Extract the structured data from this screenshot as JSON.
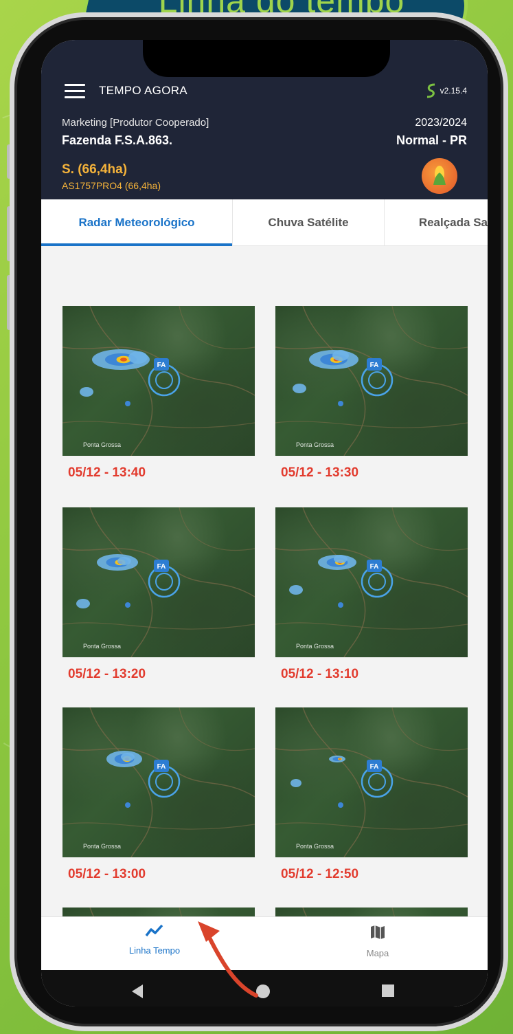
{
  "banner": {
    "title": "Linha do tempo"
  },
  "header": {
    "app_title": "TEMPO AGORA",
    "version": "v2.15.4",
    "role": "Marketing [Produtor Cooperado]",
    "farm": "Fazenda F.S.A.863.",
    "season": "2023/2024",
    "season_type": "Normal - PR",
    "plot": "S. (66,4ha)",
    "plot_detail": "AS1757PRO4 (66,4ha)",
    "crop_icon": "corn-icon"
  },
  "tabs": [
    {
      "label": "Radar Meteorológico",
      "active": true
    },
    {
      "label": "Chuva Satélite",
      "active": false
    },
    {
      "label": "Realçada Sa",
      "active": false
    }
  ],
  "radar_images": [
    {
      "timestamp": "05/12 - 13:40"
    },
    {
      "timestamp": "05/12 - 13:30"
    },
    {
      "timestamp": "05/12 - 13:20"
    },
    {
      "timestamp": "05/12 - 13:10"
    },
    {
      "timestamp": "05/12 - 13:00"
    },
    {
      "timestamp": "05/12 - 12:50"
    }
  ],
  "map_labels": {
    "farm_marker": "FA",
    "city": "Ponta Grossa"
  },
  "bottom_nav": [
    {
      "label": "Linha Tempo",
      "icon": "timeline-chart-icon",
      "active": true
    },
    {
      "label": "Mapa",
      "icon": "map-icon",
      "active": false
    }
  ],
  "colors": {
    "header_bg": "#1f2537",
    "accent": "#1a73c8",
    "timestamp": "#e23b2e",
    "plot": "#f5b33a",
    "banner_text": "#9fd44c"
  }
}
